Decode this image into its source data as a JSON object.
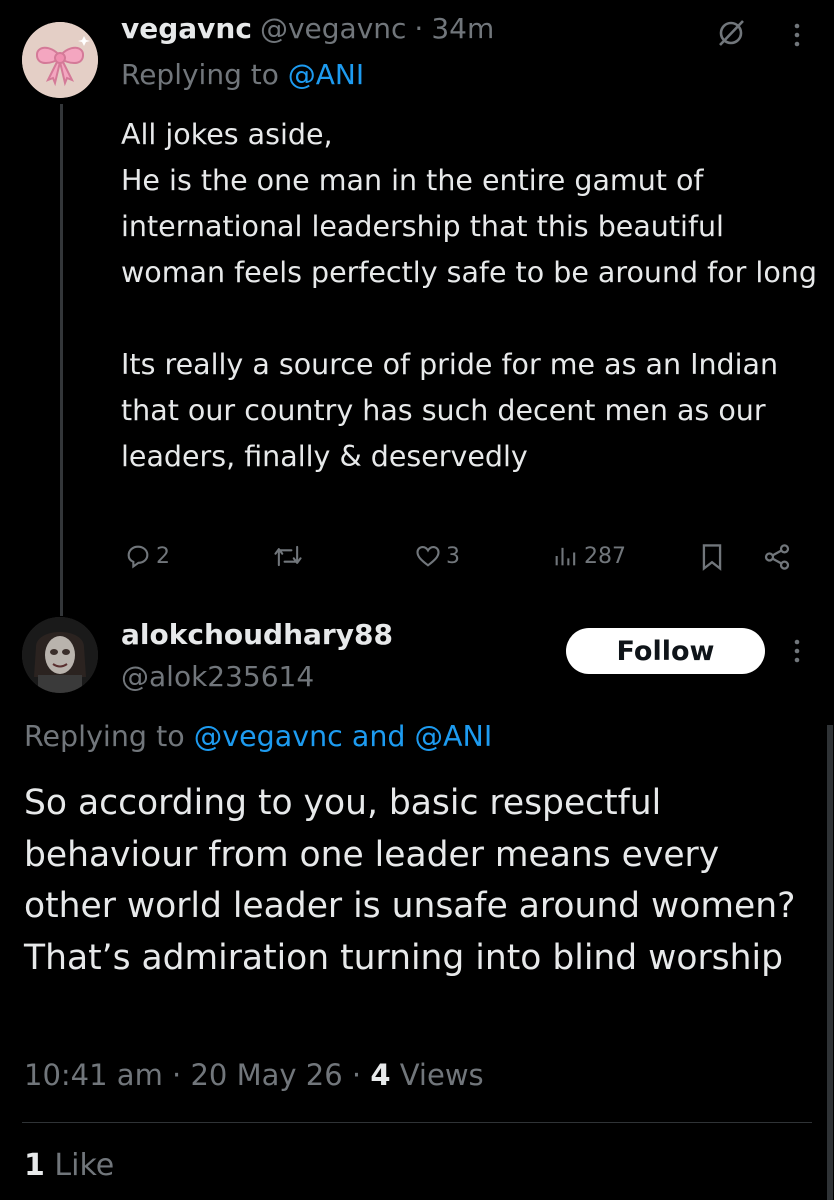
{
  "tweet1": {
    "display_name": "vegavnc",
    "handle": "@vegavnc",
    "separator": "·",
    "time": "34m",
    "replying_prefix": "Replying to",
    "replying_to": "@ANI",
    "text": "All jokes aside,\nHe is the one man in the entire gamut of international leadership that this beautiful woman feels perfectly safe to be around for long\n\nIts really a source of pride for me as an Indian that our country has such decent men as our leaders, finally & deservedly",
    "replies": "2",
    "likes": "3",
    "views": "287"
  },
  "tweet2": {
    "display_name": "alokchoudhary88",
    "handle": "@alok235614",
    "follow_label": "Follow",
    "replying_prefix": "Replying to",
    "replying_to": "@vegavnc and @ANI",
    "text": "So according to you, basic respectful behaviour from one leader means every other world leader is unsafe around women? That’s admiration turning into blind worship",
    "timestamp": "10:41 am · 20 May 26 ·",
    "views_count": "4",
    "views_label": "Views",
    "like_count": "1",
    "like_label": "Like"
  },
  "colors": {
    "background": "#000000",
    "text": "#e7e9ea",
    "muted": "#71767b",
    "link": "#1d9bf0",
    "avatar_bg": "#e4cfc6",
    "bow": "#f4a6c0"
  },
  "icons": [
    "grok-icon",
    "more-icon",
    "reply-icon",
    "retweet-icon",
    "like-icon",
    "views-icon",
    "bookmark-icon",
    "share-icon"
  ]
}
